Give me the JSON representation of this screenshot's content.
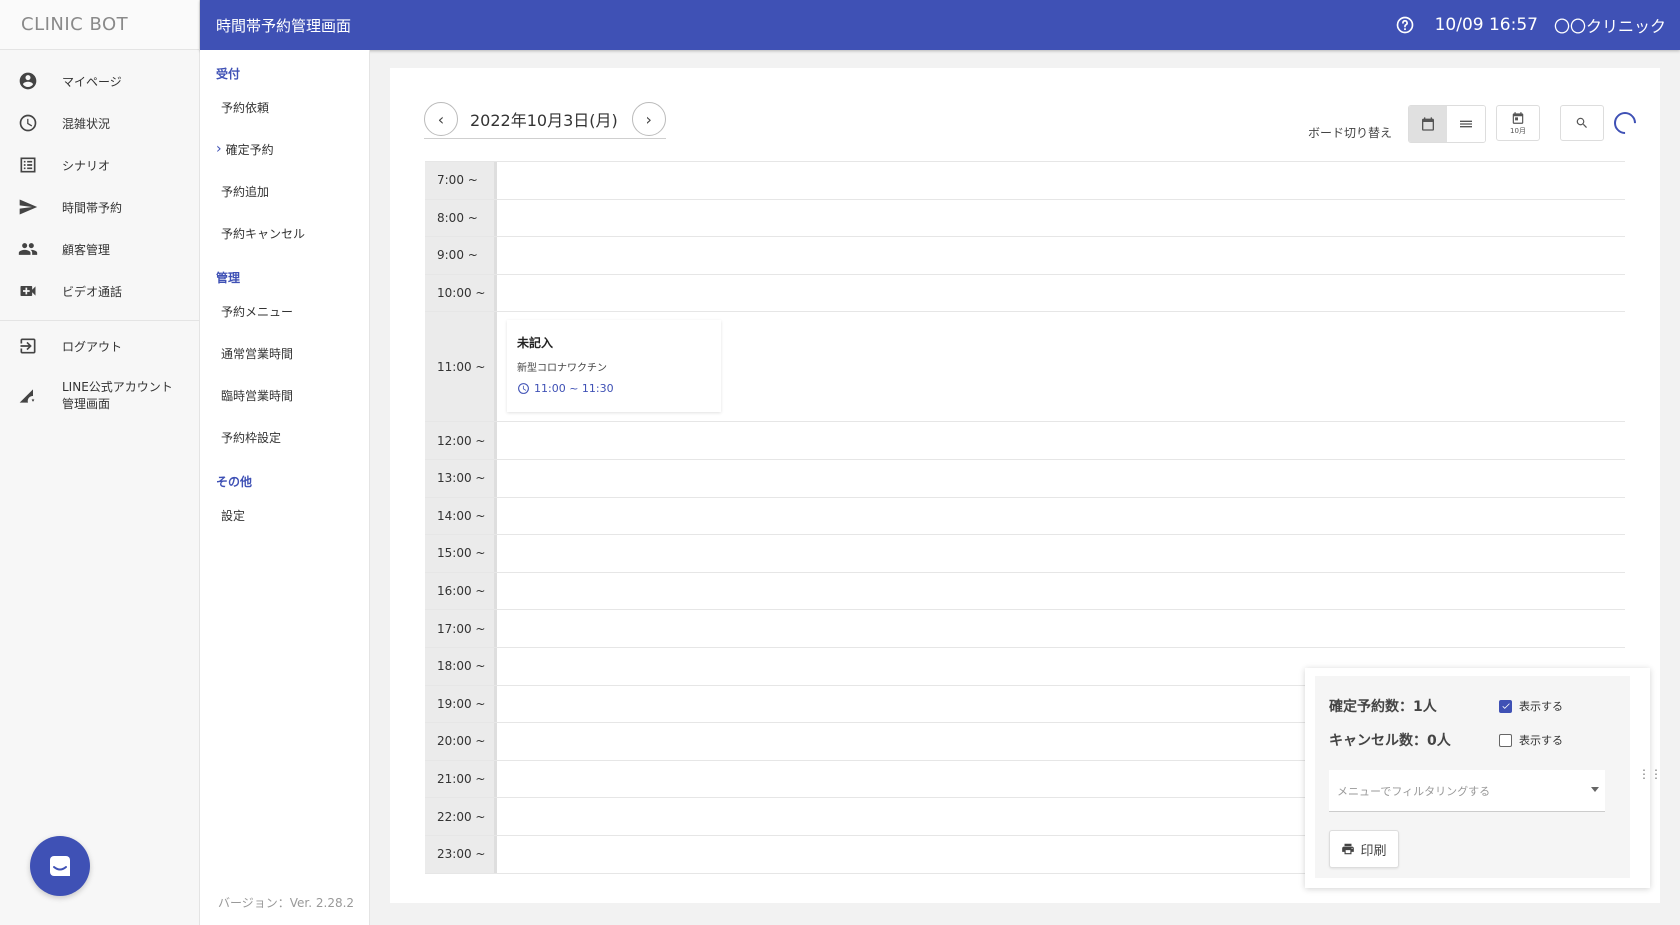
{
  "app": {
    "logo": "CLINIC BOT",
    "page_title": "時間帯予約管理画面",
    "datetime": "10/09 16:57",
    "clinic_name": "〇〇クリニック"
  },
  "sidebar": {
    "items": [
      {
        "label": "マイページ",
        "icon": "account-circle-icon"
      },
      {
        "label": "混雑状況",
        "icon": "clock-icon"
      },
      {
        "label": "シナリオ",
        "icon": "list-icon"
      },
      {
        "label": "時間帯予約",
        "icon": "send-icon"
      },
      {
        "label": "顧客管理",
        "icon": "people-icon"
      },
      {
        "label": "ビデオ通話",
        "icon": "video-icon"
      }
    ],
    "logout_label": "ログアウト",
    "line_label": "LINE公式アカウント\n管理画面"
  },
  "subnav": {
    "section_reception": "受付",
    "reception_items": [
      "予約依頼",
      "確定予約",
      "予約追加",
      "予約キャンセル"
    ],
    "section_admin": "管理",
    "admin_items": [
      "予約メニュー",
      "通常営業時間",
      "臨時営業時間",
      "予約枠設定"
    ],
    "section_other": "その他",
    "other_items": [
      "設定"
    ],
    "version": "バージョン：Ver. 2.28.2"
  },
  "toolbar": {
    "date_label": "2022年10月3日(月)",
    "board_switch_label": "ボード切り替え",
    "month_label": "10月"
  },
  "schedule": {
    "times": [
      "7:00 ~",
      "8:00 ~",
      "9:00 ~",
      "10:00 ~",
      "11:00 ~",
      "12:00 ~",
      "13:00 ~",
      "14:00 ~",
      "15:00 ~",
      "16:00 ~",
      "17:00 ~",
      "18:00 ~",
      "19:00 ~",
      "20:00 ~",
      "21:00 ~",
      "22:00 ~",
      "23:00 ~"
    ],
    "event": {
      "name": "未記入",
      "menu": "新型コロナワクチン",
      "time": "11:00 ~ 11:30"
    }
  },
  "summary": {
    "confirmed_count": "確定予約数：1人",
    "cancel_count": "キャンセル数：0人",
    "show_label_1": "表示する",
    "show_label_2": "表示する",
    "filter_placeholder": "メニューでフィルタリングする",
    "print_label": "印刷"
  },
  "colors": {
    "primary": "#3f51b5"
  }
}
